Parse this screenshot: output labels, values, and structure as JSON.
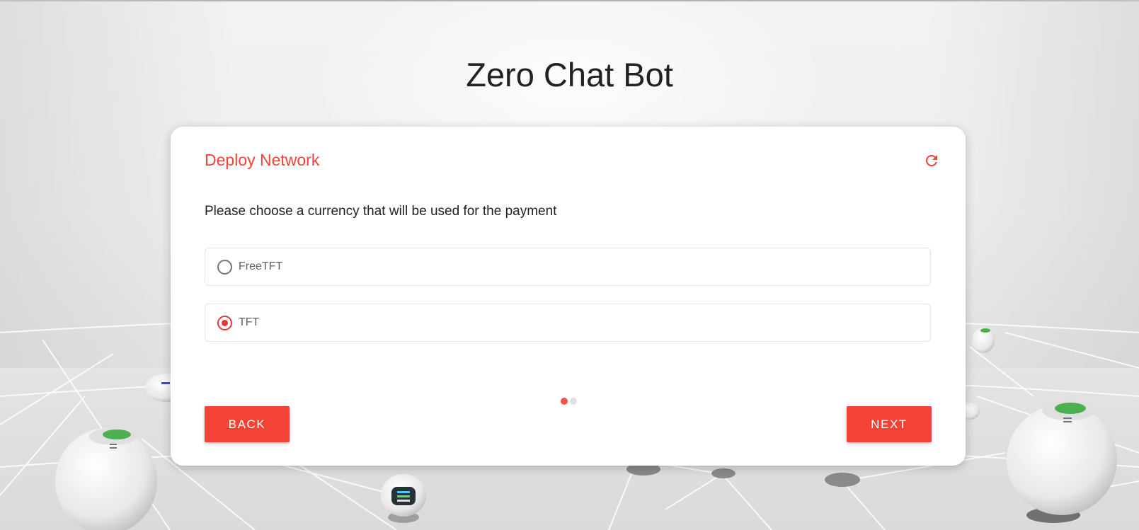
{
  "app": {
    "title": "Zero Chat Bot"
  },
  "card": {
    "title": "Deploy Network",
    "question": "Please choose a currency that will be used for the payment",
    "options": [
      {
        "label": "FreeTFT",
        "selected": false
      },
      {
        "label": "TFT",
        "selected": true
      }
    ],
    "stepper": {
      "current": 1,
      "total": 2
    },
    "back_label": "BACK",
    "next_label": "NEXT",
    "refresh_icon": "refresh-icon"
  },
  "colors": {
    "accent": "#f44336",
    "radio_selected": "#e53935",
    "step_active": "#ef5350",
    "step_inactive": "#e0e0e0",
    "text": "#222222"
  }
}
